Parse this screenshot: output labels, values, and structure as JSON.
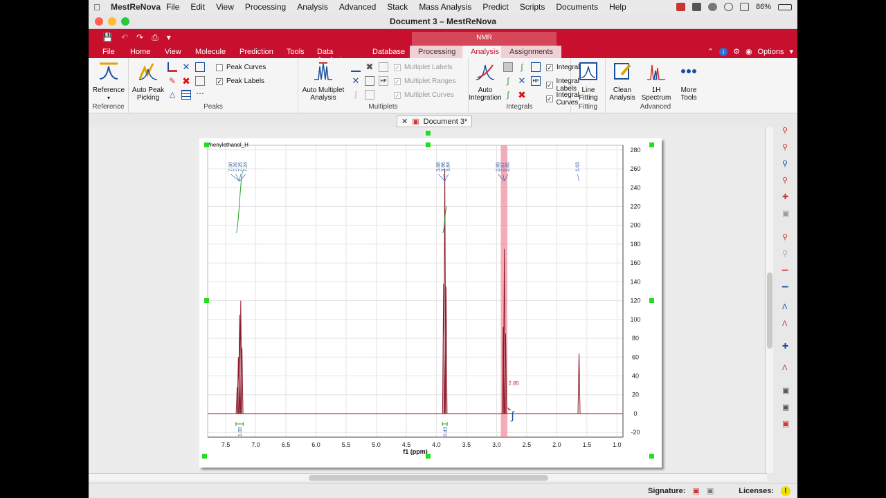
{
  "menubar": {
    "app_name": "MestReNova",
    "items": [
      "File",
      "Edit",
      "View",
      "Processing",
      "Analysis",
      "Advanced",
      "Stack",
      "Mass Analysis",
      "Predict",
      "Scripts",
      "Documents",
      "Help"
    ],
    "battery": "86%"
  },
  "window": {
    "title": "Document 3 – MestReNova"
  },
  "ribbon": {
    "context_label": "NMR",
    "tabs": [
      "File",
      "Home",
      "View",
      "Molecule",
      "Prediction",
      "Tools",
      "Data Analysis",
      "Database",
      "Processing",
      "Analysis",
      "Assignments"
    ],
    "options_label": "Options",
    "groups": {
      "reference": {
        "label": "Reference",
        "button": "Reference"
      },
      "peaks": {
        "label": "Peaks",
        "auto_peak_picking": "Auto Peak Picking",
        "peak_curves": "Peak Curves",
        "peak_labels": "Peak Labels"
      },
      "multiplets": {
        "label": "Multiplets",
        "auto_multiplet_analysis": "Auto Multiplet Analysis",
        "multiplet_labels": "Multiplet Labels",
        "multiplet_ranges": "Multiplet Ranges",
        "multiplet_curves": "Multiplet Curves"
      },
      "integrals": {
        "label": "Integrals",
        "auto_integration": "Auto Integration",
        "integrals": "Integrals",
        "integral_labels": "Integral Labels",
        "integral_curves": "Integral Curves"
      },
      "fitting": {
        "label": "Fitting",
        "line_fitting": "Line Fitting"
      },
      "advanced": {
        "label": "Advanced",
        "clean_analysis": "Clean Analysis",
        "spectrum_1h": "1H Spectrum",
        "more_tools": "More Tools"
      }
    }
  },
  "document": {
    "tab_label": "Document 3*"
  },
  "status": {
    "signature_label": "Signature:",
    "licenses_label": "Licenses:"
  },
  "colors": {
    "ribbon_red": "#c8102e",
    "spectrum": "#8b1a2b",
    "integral": "#2e9e2e",
    "highlight": "#f08a9a"
  },
  "chart_data": {
    "type": "line",
    "title": "Phenylethanol_H",
    "xlabel": "f1 (ppm)",
    "ylabel": "",
    "xlim": [
      7.8,
      0.9
    ],
    "ylim": [
      -25,
      285
    ],
    "x_ticks": [
      "7.5",
      "7.0",
      "6.5",
      "6.0",
      "5.5",
      "5.0",
      "4.5",
      "4.0",
      "3.5",
      "3.0",
      "2.5",
      "2.0",
      "1.5",
      "1.0"
    ],
    "y_ticks": [
      "280",
      "260",
      "240",
      "220",
      "200",
      "180",
      "160",
      "140",
      "120",
      "100",
      "80",
      "60",
      "40",
      "20",
      "0",
      "-20"
    ],
    "peaks": [
      {
        "ppm": 7.31,
        "height": 28
      },
      {
        "ppm": 7.29,
        "height": 60
      },
      {
        "ppm": 7.27,
        "height": 105
      },
      {
        "ppm": 7.25,
        "height": 120
      },
      {
        "ppm": 7.23,
        "height": 70
      },
      {
        "ppm": 3.88,
        "height": 138
      },
      {
        "ppm": 3.86,
        "height": 260
      },
      {
        "ppm": 3.84,
        "height": 135
      },
      {
        "ppm": 2.89,
        "height": 92
      },
      {
        "ppm": 2.87,
        "height": 175
      },
      {
        "ppm": 2.85,
        "height": 85
      },
      {
        "ppm": 1.63,
        "height": 64
      }
    ],
    "peak_label_groups": [
      {
        "ppm": 7.27,
        "labels": [
          "7.30",
          "7.26",
          "7.25",
          "7.24"
        ]
      },
      {
        "ppm": 3.86,
        "labels": [
          "3.88",
          "3.86",
          "3.84"
        ]
      },
      {
        "ppm": 2.87,
        "labels": [
          "2.89",
          "2.87",
          "2.85"
        ]
      },
      {
        "ppm": 1.63,
        "labels": [
          "1.63"
        ]
      }
    ],
    "integrals": [
      {
        "from": 7.33,
        "to": 7.21,
        "value": "1.00",
        "curve_low": 192,
        "curve_high": 258
      },
      {
        "from": 3.9,
        "to": 3.82,
        "value": "0.43",
        "curve_low": 192,
        "curve_high": 220
      }
    ],
    "highlight_range": [
      2.93,
      2.82
    ],
    "cursor_label": "2.85"
  }
}
